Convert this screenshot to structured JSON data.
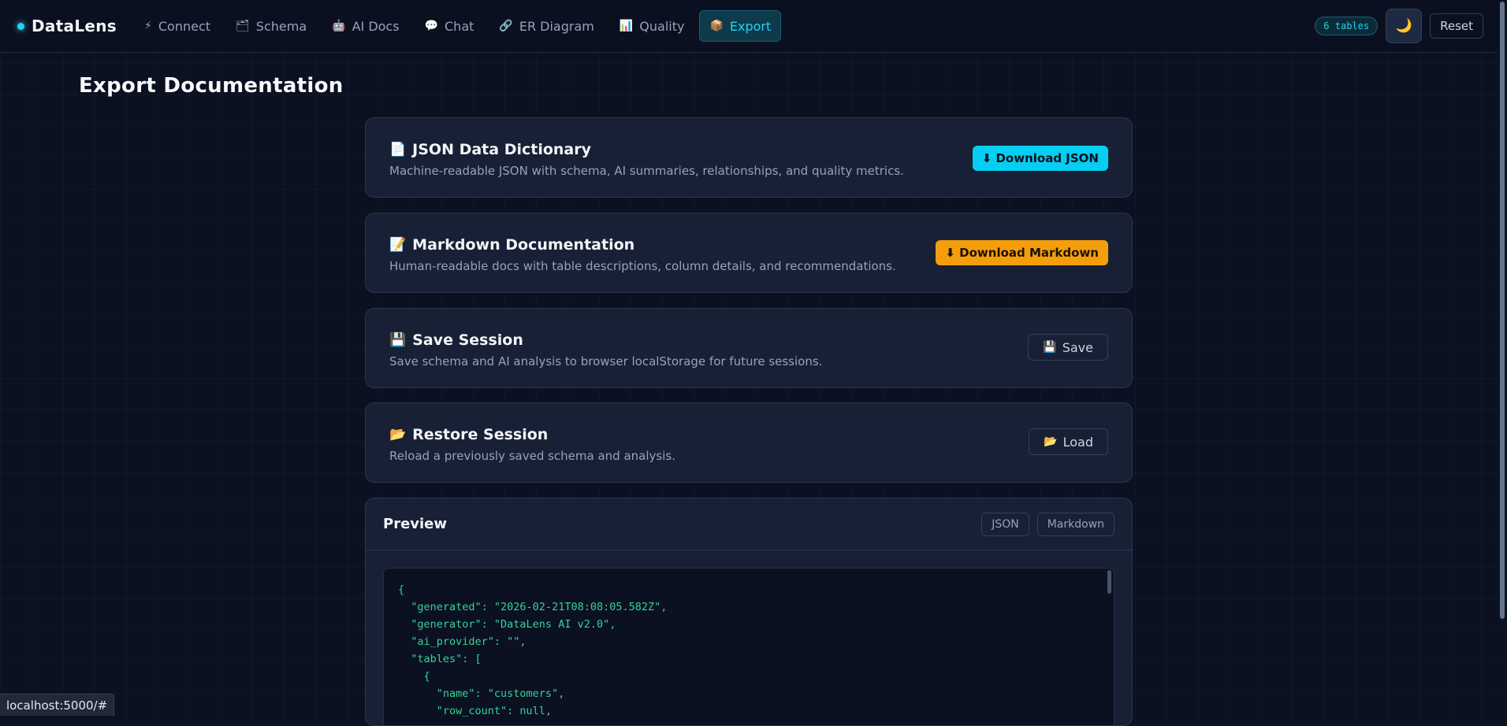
{
  "app": {
    "name": "DataLens"
  },
  "nav": {
    "tabs": [
      {
        "icon": "⚡",
        "label": "Connect"
      },
      {
        "icon": "🗂",
        "label": "Schema"
      },
      {
        "icon": "🤖",
        "label": "AI Docs"
      },
      {
        "icon": "💬",
        "label": "Chat"
      },
      {
        "icon": "🔗",
        "label": "ER Diagram"
      },
      {
        "icon": "📊",
        "label": "Quality"
      },
      {
        "icon": "📦",
        "label": "Export"
      }
    ],
    "active_tab": "Export",
    "table_count": "6 tables",
    "theme_icon": "🌙",
    "reset_label": "Reset"
  },
  "page": {
    "title": "Export Documentation"
  },
  "cards": [
    {
      "icon": "📄",
      "title": "JSON Data Dictionary",
      "description": "Machine-readable JSON with schema, AI summaries, relationships, and quality metrics.",
      "button_label": "⬇ Download JSON"
    },
    {
      "icon": "📝",
      "title": "Markdown Documentation",
      "description": "Human-readable docs with table descriptions, column details, and recommendations.",
      "button_label": "⬇ Download Markdown"
    },
    {
      "icon": "💾",
      "title": "Save Session",
      "description": "Save schema and AI analysis to browser localStorage for future sessions.",
      "button_icon": "💾",
      "button_label": "Save"
    },
    {
      "icon": "📂",
      "title": "Restore Session",
      "description": "Reload a previously saved schema and analysis.",
      "button_icon": "📂",
      "button_label": "Load"
    }
  ],
  "preview": {
    "title": "Preview",
    "toggles": [
      "JSON",
      "Markdown"
    ],
    "code_lines": [
      "{",
      "  \"generated\": \"2026-02-21T08:08:05.582Z\",",
      "  \"generator\": \"DataLens AI v2.0\",",
      "  \"ai_provider\": \"\",",
      "  \"tables\": [",
      "    {",
      "      \"name\": \"customers\",",
      "      \"row_count\": null,"
    ]
  },
  "status_bar": {
    "url": "localhost:5000/#"
  },
  "colors": {
    "accent_cyan": "#06cdf2",
    "accent_amber": "#f59e0b",
    "background": "#0b1120",
    "code_green": "#34d399"
  }
}
